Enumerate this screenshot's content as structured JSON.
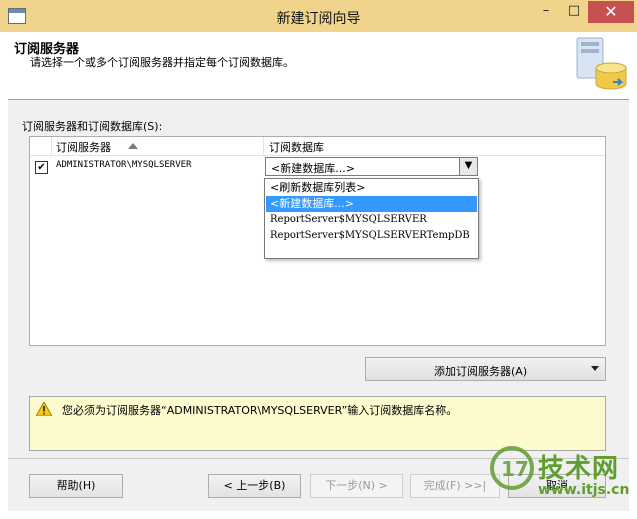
{
  "window": {
    "title": "新建订阅向导",
    "controls": {
      "minimize": "–",
      "maximize": "□",
      "close": "✕"
    }
  },
  "header": {
    "title": "订阅服务器",
    "subtitle": "请选择一个或多个订阅服务器并指定每个订阅数据库。"
  },
  "grid": {
    "label": "订阅服务器和订阅数据库(S):",
    "columns": [
      "订阅服务器",
      "订阅数据库"
    ],
    "rows": [
      {
        "checked": true,
        "server": "ADMINISTRATOR\\MYSQLSERVER",
        "database": "<新建数据库...>"
      }
    ]
  },
  "dropdown": {
    "options": [
      "<刷新数据库列表>",
      "<新建数据库...>",
      "ReportServer$MYSQLSERVER",
      "ReportServer$MYSQLSERVERTempDB"
    ],
    "selected_index": 1
  },
  "add_subscriber_button": "添加订阅服务器(A)",
  "message": "您必须为订阅服务器“ADMINISTRATOR\\MYSQLSERVER”输入订阅数据库名称。",
  "footer": {
    "help": "帮助(H)",
    "back": "< 上一步(B)",
    "next": "下一步(N) >",
    "finish": "完成(F) >>|",
    "cancel": "取消"
  },
  "watermark": {
    "brand": "技术网",
    "url": "www.itjs.cn"
  },
  "colors": {
    "titlebar": "#f1d48b",
    "selection": "#3399ff",
    "message_bg": "#fbfbcd",
    "watermark": "#5f9e2f"
  }
}
